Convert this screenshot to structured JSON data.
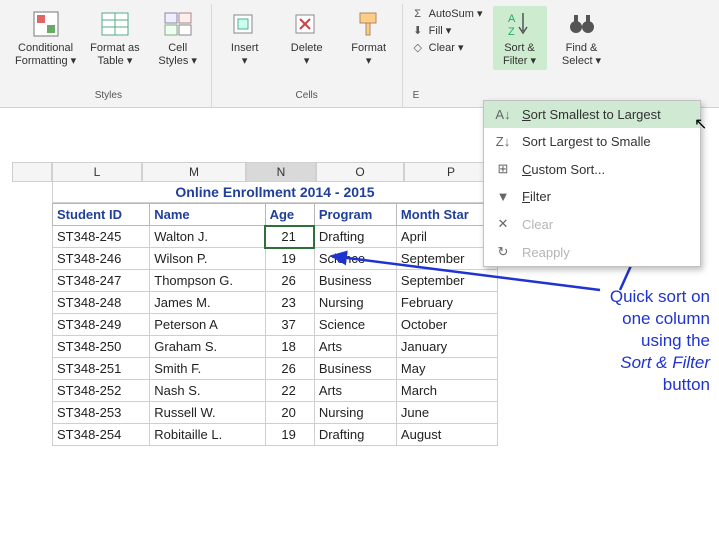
{
  "ribbon": {
    "styles": {
      "cond_fmt_l1": "Conditional",
      "cond_fmt_l2": "Formatting ▾",
      "fmt_table_l1": "Format as",
      "fmt_table_l2": "Table ▾",
      "cell_styles_l1": "Cell",
      "cell_styles_l2": "Styles ▾",
      "group_label": "Styles"
    },
    "cells": {
      "insert_l1": "Insert",
      "insert_l2": "▾",
      "delete_l1": "Delete",
      "delete_l2": "▾",
      "format_l1": "Format",
      "format_l2": "▾",
      "group_label": "Cells"
    },
    "editing": {
      "autosum": "AutoSum ▾",
      "fill": "Fill ▾",
      "clear": "Clear ▾",
      "sort_l1": "Sort &",
      "sort_l2": "Filter ▾",
      "find_l1": "Find &",
      "find_l2": "Select ▾",
      "group_label": "E"
    }
  },
  "menu": {
    "sort_asc": "Sort Smallest to Largest",
    "sort_desc": "Sort Largest to Smalle",
    "custom": "Custom Sort...",
    "filter": "Filter",
    "clear": "Clear",
    "reapply": "Reapply"
  },
  "columns": [
    "",
    "L",
    "M",
    "N",
    "O",
    "P"
  ],
  "title": "Online Enrollment 2014 - 2015",
  "headers": [
    "Student ID",
    "Name",
    "Age",
    "Program",
    "Month Star"
  ],
  "rows": [
    {
      "id": "ST348-245",
      "name": "Walton J.",
      "age": "21",
      "program": "Drafting",
      "month": "April"
    },
    {
      "id": "ST348-246",
      "name": "Wilson P.",
      "age": "19",
      "program": "Science",
      "month": "September"
    },
    {
      "id": "ST348-247",
      "name": "Thompson G.",
      "age": "26",
      "program": "Business",
      "month": "September"
    },
    {
      "id": "ST348-248",
      "name": "James M.",
      "age": "23",
      "program": "Nursing",
      "month": "February"
    },
    {
      "id": "ST348-249",
      "name": "Peterson A",
      "age": "37",
      "program": "Science",
      "month": "October"
    },
    {
      "id": "ST348-250",
      "name": "Graham S.",
      "age": "18",
      "program": "Arts",
      "month": "January"
    },
    {
      "id": "ST348-251",
      "name": "Smith F.",
      "age": "26",
      "program": "Business",
      "month": "May"
    },
    {
      "id": "ST348-252",
      "name": "Nash S.",
      "age": "22",
      "program": "Arts",
      "month": "March"
    },
    {
      "id": "ST348-253",
      "name": "Russell W.",
      "age": "20",
      "program": "Nursing",
      "month": "June"
    },
    {
      "id": "ST348-254",
      "name": "Robitaille L.",
      "age": "19",
      "program": "Drafting",
      "month": "August"
    }
  ],
  "annotation": {
    "l1": "Quick sort on",
    "l2": "one column",
    "l3": "using the",
    "l4": "Sort & Filter",
    "l5": "button"
  }
}
